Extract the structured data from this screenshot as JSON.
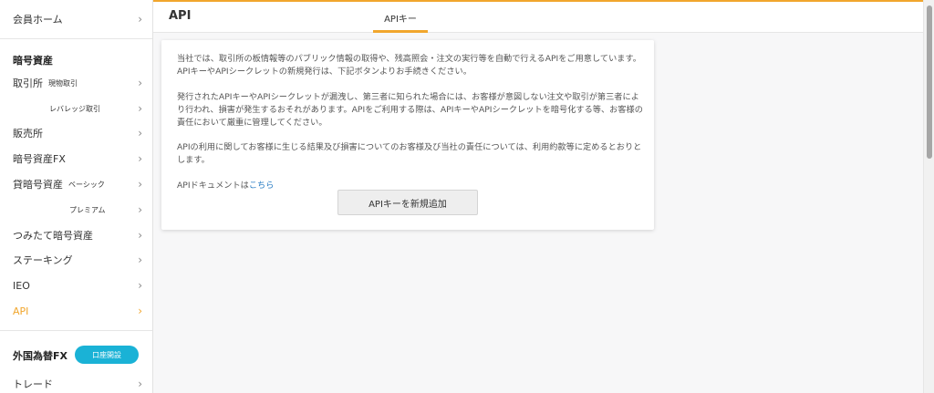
{
  "sidebar": {
    "member_home": "会員ホーム",
    "crypto_section": "暗号資産",
    "items": [
      {
        "label": "取引所",
        "sub": "現物取引"
      },
      {
        "label": "",
        "sub": "レバレッジ取引"
      },
      {
        "label": "販売所",
        "sub": ""
      },
      {
        "label": "暗号資産FX",
        "sub": ""
      },
      {
        "label": "貸暗号資産",
        "sub": "ベーシック"
      },
      {
        "label": "",
        "sub": "プレミアム"
      },
      {
        "label": "つみたて暗号資産",
        "sub": ""
      },
      {
        "label": "ステーキング",
        "sub": ""
      },
      {
        "label": "IEO",
        "sub": ""
      },
      {
        "label": "API",
        "sub": ""
      }
    ],
    "fx_section": "外国為替FX",
    "open_account_button": "口座開設",
    "trade": "トレード",
    "chevron": "›"
  },
  "header": {
    "title": "API",
    "tab": "APIキー"
  },
  "card": {
    "para1": "当社では、取引所の板情報等のパブリック情報の取得や、残高照会・注文の実行等を自動で行えるAPIをご用意しています。APIキーやAPIシークレットの新規発行は、下記ボタンよりお手続きください。",
    "para2": "発行されたAPIキーやAPIシークレットが漏洩し、第三者に知られた場合には、お客様が意図しない注文や取引が第三者により行われ、損害が発生するおそれがあります。APIをご利用する際は、APIキーやAPIシークレットを暗号化する等、お客様の責任において厳重に管理してください。",
    "para3": "APIの利用に関してお客様に生じる結果及び損害についてのお客様及び当社の責任については、利用約款等に定めるとおりとします。",
    "doc_prefix": "APIドキュメントは",
    "doc_link": "こちら",
    "add_button": "APIキーを新規追加"
  },
  "colors": {
    "accent": "#f1a62d",
    "cta": "#1ab2d6",
    "link": "#2a7dc4"
  }
}
